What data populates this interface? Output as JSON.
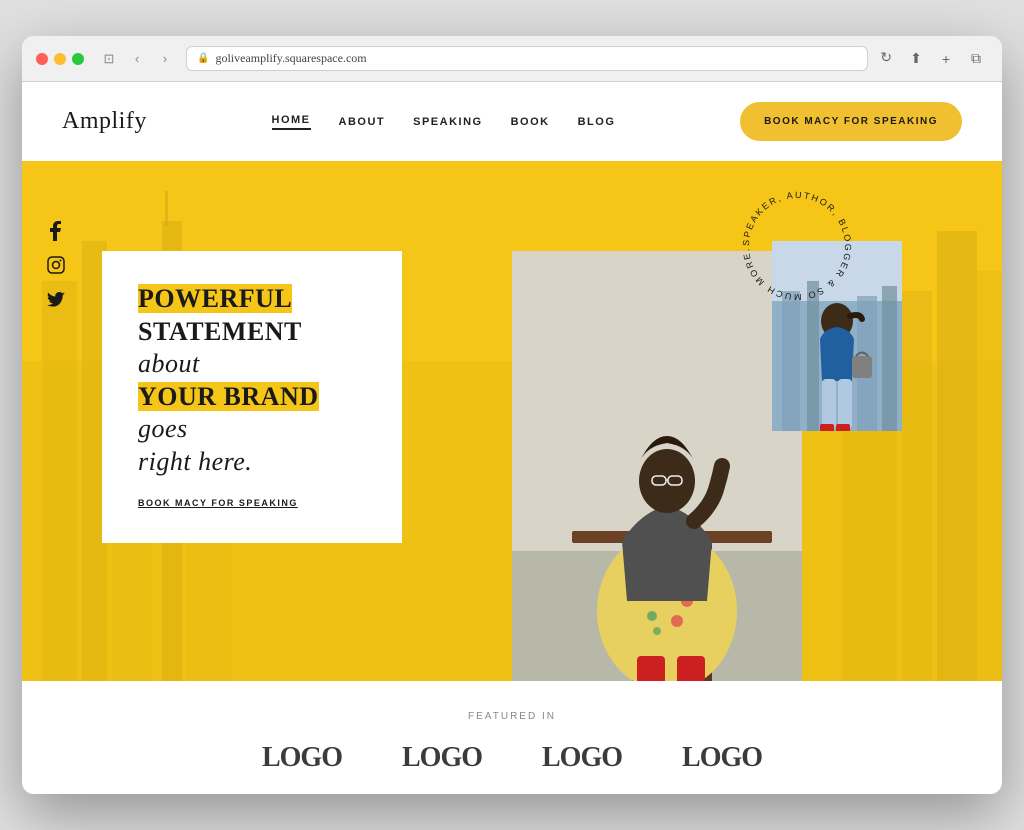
{
  "browser": {
    "url": "goliveamplify.squarespace.com",
    "refresh_title": "↻"
  },
  "site": {
    "logo": "Amplify",
    "nav": {
      "links": [
        {
          "label": "HOME",
          "active": true
        },
        {
          "label": "ABOUT",
          "active": false
        },
        {
          "label": "SPEAKING",
          "active": false
        },
        {
          "label": "BOOK",
          "active": false
        },
        {
          "label": "BLOG",
          "active": false
        }
      ],
      "cta": "BOOK MACY FOR SPEAKING"
    },
    "hero": {
      "circular_text": "SPEAKER, AUTHOR, BLOGGER & SO MUCH MORE.",
      "statement_line1": "POWERFUL",
      "statement_line2": "STATEMENT",
      "statement_italic1": "about",
      "statement_line3": "YOUR BRAND",
      "statement_italic2": "goes",
      "statement_line4": "right here.",
      "cta_link": "BOOK MACY FOR SPEAKING"
    },
    "social": {
      "icons": [
        "f",
        "instagram",
        "twitter"
      ]
    },
    "featured": {
      "label": "FEATURED IN",
      "logos": [
        "LOGO",
        "LOGO",
        "LOGO",
        "LOGO"
      ]
    }
  }
}
